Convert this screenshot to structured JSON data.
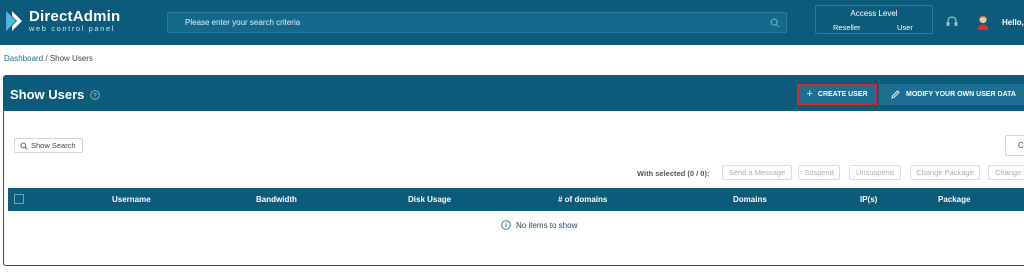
{
  "app": {
    "logo_title": "DirectAdmin",
    "logo_subtitle": "web control panel"
  },
  "header": {
    "search_placeholder": "Please enter your search criteria",
    "access_level_title": "Access Level",
    "access_levels": [
      "Reseller",
      "User"
    ],
    "greeting": "Hello,"
  },
  "breadcrumb": {
    "home": "Dashboard",
    "separator": " / ",
    "current": "Show Users"
  },
  "panel": {
    "title": "Show Users",
    "create_button": "CREATE USER",
    "modify_button": "MODIFY YOUR OWN USER DATA",
    "show_search": "Show Search",
    "columns_button": "Co"
  },
  "bulk_actions": {
    "label": "With selected (0 / 0):",
    "items": [
      "Send a Message",
      "Suspend",
      "Unsuspend",
      "Change Package",
      "Change"
    ]
  },
  "table": {
    "columns": [
      "Username",
      "Bandwidth",
      "Disk Usage",
      "# of domains",
      "Domains",
      "IP(s)",
      "Package"
    ],
    "empty_text": "No items to show"
  },
  "colors": {
    "header_bg": "#0d5b7a",
    "highlight_border": "#d9242b",
    "button_bg": "#1d6e90"
  }
}
